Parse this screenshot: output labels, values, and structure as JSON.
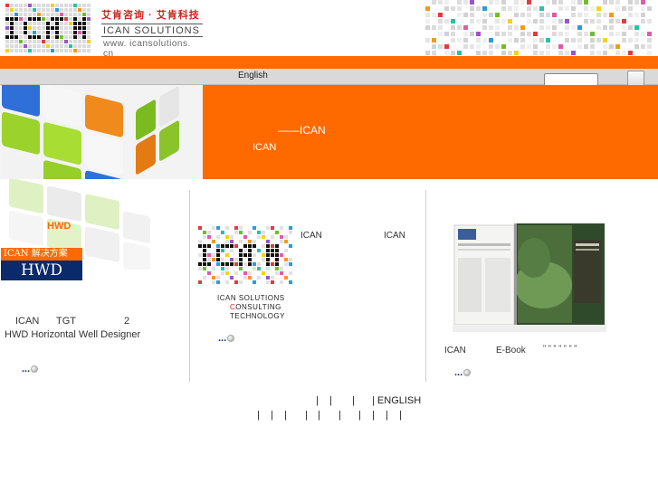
{
  "header": {
    "brand_cn": "艾肯咨询 · 艾肯科技",
    "brand_en": "ICAN SOLUTIONS",
    "brand_url": "www. icansolutions. cn"
  },
  "nav": {
    "english": "English",
    "search_value": ""
  },
  "banner": {
    "line1": "——ICAN",
    "line2": "ICAN"
  },
  "column1": {
    "hwd_label": "HWD",
    "badge_top": "ICAN 解决方案",
    "badge_bottom": "HWD",
    "text_a": "ICAN",
    "text_b": "TGT",
    "text_c": "2",
    "text_line2": "HWD Horizontal Well Designer",
    "more": "..."
  },
  "column2": {
    "ican1": "ICAN",
    "ican2": "ICAN",
    "logo_line1": "ICAN SOLUTIONS",
    "logo_line2_c": "C",
    "logo_line2_rest": "ONSULTING",
    "logo_line3": "TECHNOLOGY",
    "more": "..."
  },
  "column3": {
    "ican": "ICAN",
    "ebook": "E-Book",
    "quotes": "\"  \"        \"  \"         \"  \"        \"",
    "more": "..."
  },
  "footer": {
    "english": "| ENGLISH"
  },
  "colors": {
    "orange": "#ff6a00",
    "navy": "#0a2a6b",
    "link": "#0b2f8a"
  }
}
